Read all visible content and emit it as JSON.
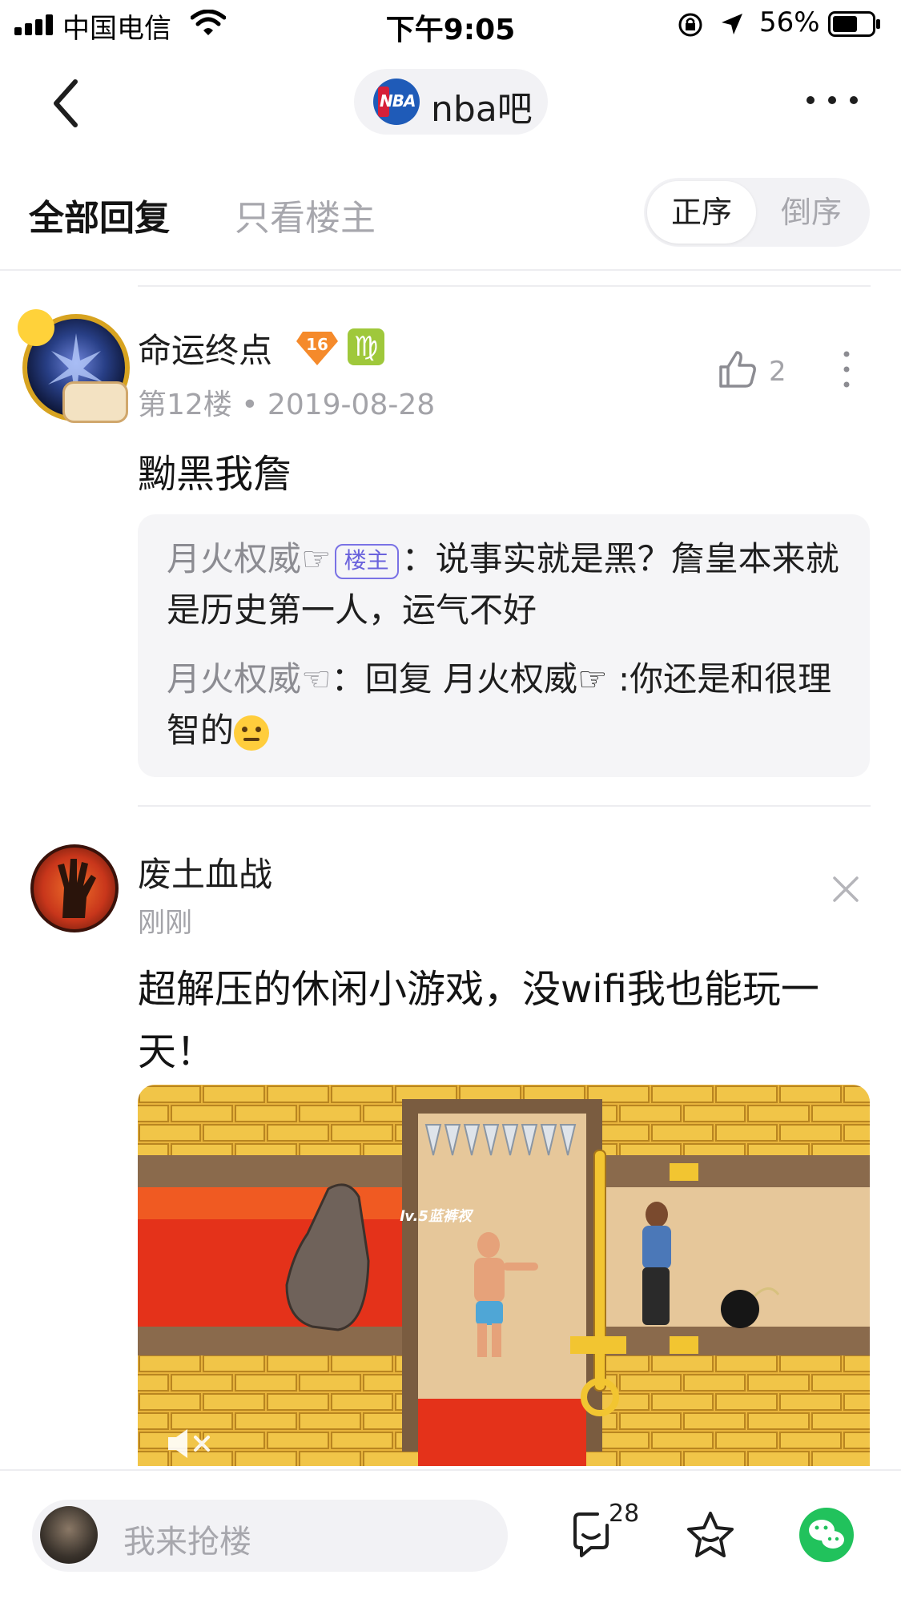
{
  "status_bar": {
    "carrier": "中国电信",
    "time": "下午9:05",
    "battery": "56%"
  },
  "nav": {
    "forum_name": "nba吧",
    "forum_logo_text": "NBA"
  },
  "tabs": {
    "all": "全部回复",
    "op_only": "只看楼主",
    "order_asc": "正序",
    "order_desc": "倒序"
  },
  "post": {
    "username": "命运终点",
    "level": "16",
    "zodiac": "♍",
    "floor_info": "第12楼 • 2019-08-28",
    "likes": "2",
    "content": "黝黑我詹",
    "replies": [
      {
        "author": "月火权威☞",
        "badge": "楼主",
        "text": "：说事实就是黑？詹皇本来就是历史第一人，运气不好"
      },
      {
        "author": "月火权威☜",
        "text": "：回复 月火权威☞ :你还是和很理智的"
      }
    ]
  },
  "ad": {
    "username": "废土血战",
    "time": "刚刚",
    "content": "超解压的休闲小游戏，没wifi我也能玩一天！",
    "image_label": "lv.5蓝裤衩"
  },
  "bottom_bar": {
    "input_placeholder": "我来抢楼",
    "comment_count": "28"
  },
  "colors": {
    "accent_wechat": "#21c25c",
    "badge_border": "#7a72e5",
    "muted_text": "#a3a3a8"
  }
}
